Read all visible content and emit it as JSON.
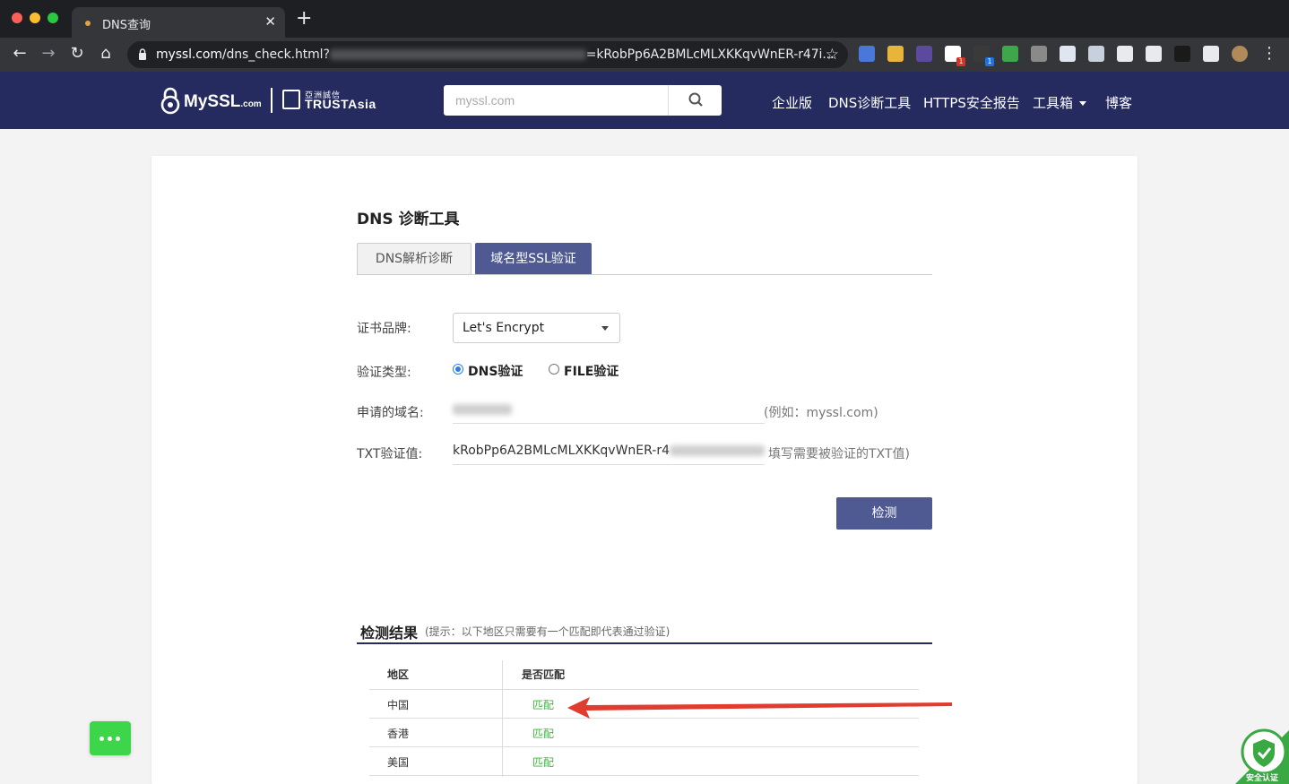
{
  "browser": {
    "tab_title": "DNS查询",
    "tab_close": "✕",
    "new_tab": "+",
    "url_host": "myssl.com",
    "url_path": "/dns_check.html?",
    "url_rest": "=kRobPp6A2BMLcMLXKKqvWnER-r47i...",
    "nav": {
      "back": "←",
      "forward": "→",
      "reload": "↻",
      "home": "⌂"
    },
    "star": "☆",
    "extensions": [
      {
        "name": "translate-extension-icon",
        "color": "#4a78d8",
        "badge": ""
      },
      {
        "name": "chrome-extension-icon",
        "color": "#e8b43a",
        "badge": ""
      },
      {
        "name": "ia-extension-icon",
        "color": "#5c4a9e",
        "badge": ""
      },
      {
        "name": "notes-extension-icon",
        "color": "#ffffff",
        "badge": "1"
      },
      {
        "name": "box-extension-icon",
        "color": "#3a3a3a",
        "badge": "1"
      },
      {
        "name": "evernote-extension-icon",
        "color": "#3ea74b",
        "badge": ""
      },
      {
        "name": "info-extension-icon",
        "color": "#8a8a8a",
        "badge": ""
      },
      {
        "name": "diamond-extension-icon",
        "color": "#dfe6f0",
        "badge": ""
      },
      {
        "name": "circle-extension-icon",
        "color": "#c8d0de",
        "badge": ""
      },
      {
        "name": "cloud-extension-icon",
        "color": "#e8eaed",
        "badge": ""
      },
      {
        "name": "pen-extension-icon",
        "color": "#e8eaed",
        "badge": ""
      },
      {
        "name": "h-extension-icon",
        "color": "#1a1a1a",
        "badge": ""
      },
      {
        "name": "puzzle-extension-icon",
        "color": "#e8eaed",
        "badge": ""
      },
      {
        "name": "profile-avatar-icon",
        "color": "#b08a5a",
        "badge": ""
      }
    ],
    "menu": "⋮"
  },
  "header": {
    "logo_main": "MySSL",
    "logo_suffix": ".com",
    "logo2_cn": "亞洲誠信",
    "logo2_en": "TRUSTAsia",
    "search_placeholder": "myssl.com",
    "nav": [
      "企业版",
      "DNS诊断工具",
      "HTTPS安全报告",
      "工具箱",
      "博客"
    ]
  },
  "form": {
    "title": "DNS 诊断工具",
    "tabs": [
      "DNS解析诊断",
      "域名型SSL验证"
    ],
    "brand_label": "证书品牌:",
    "brand_value": "Let's Encrypt",
    "type_label": "验证类型:",
    "type_options": [
      "DNS验证",
      "FILE验证"
    ],
    "domain_label": "申请的域名:",
    "domain_hint": "(例如：myssl.com)",
    "txt_label": "TXT验证值:",
    "txt_value": "kRobPp6A2BMLcMLXKKqvWnER-r4",
    "txt_hint": "填写需要被验证的TXT值)",
    "check_button": "检测"
  },
  "results": {
    "title": "检测结果",
    "hint": "(提示：以下地区只需要有一个匹配即代表通过验证)",
    "columns": [
      "地区",
      "是否匹配"
    ],
    "rows": [
      {
        "region": "中国",
        "match": "匹配"
      },
      {
        "region": "香港",
        "match": "匹配"
      },
      {
        "region": "美国",
        "match": "匹配"
      }
    ]
  },
  "badge": {
    "text": "安全认证"
  },
  "colors": {
    "header_bg": "#252b5e",
    "accent": "#4e5a91",
    "match_green": "#3eb83e",
    "arrow_red": "#e03c2f"
  }
}
